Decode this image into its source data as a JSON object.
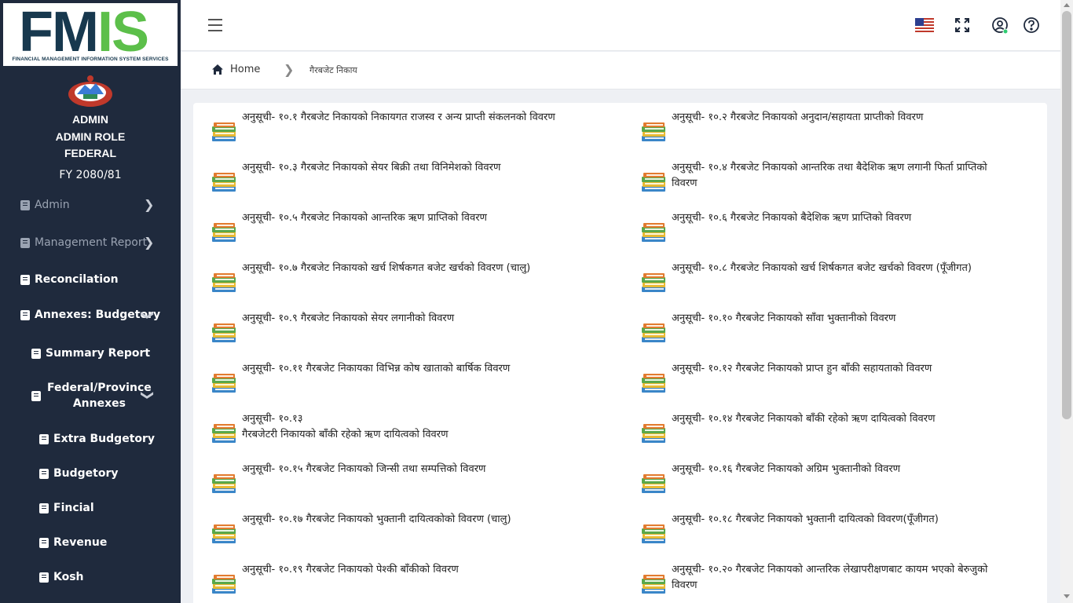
{
  "logo": {
    "main_left": "FM",
    "main_right": "IS",
    "subtitle": "FINANCIAL MANAGEMENT INFORMATION SYSTEM SERVICES"
  },
  "user": {
    "name": "ADMIN",
    "role": "ADMIN ROLE",
    "level": "FEDERAL",
    "fiscal_year": "FY 2080/81"
  },
  "sidebar": {
    "items": [
      {
        "label": "Admin"
      },
      {
        "label": "Management Report"
      },
      {
        "label": "Reconcilation"
      },
      {
        "label": "Annexes: Budgetory"
      },
      {
        "label": "Summary Report"
      },
      {
        "label": "Federal/Province",
        "label2": "Annexes"
      },
      {
        "label": "Extra Budgetory"
      },
      {
        "label": "Budgetory"
      },
      {
        "label": "Fincial"
      },
      {
        "label": "Revenue"
      },
      {
        "label": "Kosh"
      }
    ]
  },
  "breadcrumb": {
    "home": "Home",
    "current": "गैरबजेट निकाय"
  },
  "colors": {
    "sidebar_bg": "#1f2a3d",
    "brand_dark": "#17384e",
    "brand_green": "#5cbf4a",
    "online_dot": "#2ecc71"
  },
  "annexes": [
    {
      "l1": "अनुसूची- १०.१ गैरबजेट निकायको निकायगत राजस्व र अन्य प्राप्ती संकलनको विवरण",
      "l2": ""
    },
    {
      "l1": "अनुसूची- १०.२ गैरबजेट निकायको अनुदान/सहायता प्राप्तीको विवरण",
      "l2": ""
    },
    {
      "l1": "अनुसूची- १०.३ गैरबजेट निकायको सेयर बिक्री तथा विनिमेशको विवरण",
      "l2": ""
    },
    {
      "l1": "अनुसूची- १०.४ गैरबजेट निकायको आन्तरिक तथा बैदेशिक ऋण लगानी फिर्ता प्राप्तिको",
      "l2": "विवरण"
    },
    {
      "l1": "अनुसूची- १०.५ गैरबजेट निकायको आन्तरिक ऋण प्राप्तिको विवरण",
      "l2": ""
    },
    {
      "l1": "अनुसूची- १०.६ गैरबजेट निकायको बैदेशिक ऋण प्राप्तिको विवरण",
      "l2": ""
    },
    {
      "l1": "अनुसूची- १०.७ गैरबजेट निकायको खर्च शिर्षकगत बजेट खर्चको विवरण (चालु)",
      "l2": ""
    },
    {
      "l1": "अनुसूची- १०.८ गैरबजेट निकायको खर्च शिर्षकगत बजेट खर्चको विवरण (पूँजीगत)",
      "l2": ""
    },
    {
      "l1": "अनुसूची- १०.९ गैरबजेट निकायको सेयर लगानीको विवरण",
      "l2": ""
    },
    {
      "l1": "अनुसूची- १०.१० गैरबजेट निकायको साँवा भुक्तानीको विवरण",
      "l2": ""
    },
    {
      "l1": "अनुसूची- १०.११ गैरबजेट निकायका विभिन्न कोष खाताको बार्षिक विवरण",
      "l2": ""
    },
    {
      "l1": "अनुसूची- १०.१२ गैरबजेट निकायको प्राप्त हुन बाँकी सहायताको विवरण",
      "l2": ""
    },
    {
      "l1": "अनुसूची- १०.१३",
      "l2": "गैरबजेटरी निकायको बाँकी रहेको ऋण दायित्वको विवरण"
    },
    {
      "l1": "अनुसूची- १०.१४ गैरबजेट निकायको बाँकी रहेको ऋण दायित्वको विवरण",
      "l2": ""
    },
    {
      "l1": "अनुसूची- १०.१५ गैरबजेट निकायको जिन्सी तथा सम्पत्तिको विवरण",
      "l2": ""
    },
    {
      "l1": "अनुसूची- १०.१६ गैरबजेट निकायको अग्रिम भुक्तानीको विवरण",
      "l2": ""
    },
    {
      "l1": "अनुसूची- १०.१७ गैरबजेट निकायको भुक्तानी दायित्वकोको विवरण (चालु)",
      "l2": ""
    },
    {
      "l1": "अनुसूची- १०.१८ गैरबजेट निकायको भुक्तानी दायित्वको विवरण(पूँजीगत)",
      "l2": ""
    },
    {
      "l1": "अनुसूची- १०.१९ गैरबजेट निकायको पेश्की बाँकीको विवरण",
      "l2": ""
    },
    {
      "l1": "अनुसूची- १०.२० गैरबजेट निकायको आन्तरिक लेखापरीक्षणबाट कायम भएको बेरुजुको",
      "l2": "विवरण"
    }
  ]
}
